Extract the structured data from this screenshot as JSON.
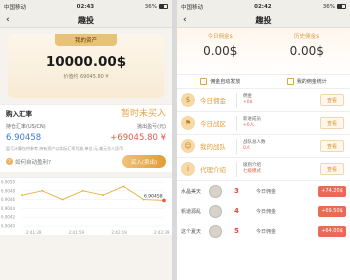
{
  "left": {
    "status": {
      "carrier": "中国移动",
      "network": "4G",
      "time": "02:43",
      "battery": "36%"
    },
    "nav": {
      "title": "趣投"
    },
    "asset": {
      "tab_label": "我的资产",
      "value": "10000.00$",
      "sub": "价值约 69045.80 ¥"
    },
    "rate": {
      "title": "购入汇率",
      "state": "暂时未买入",
      "label_left": "持仓汇率(US/CN)",
      "label_right": "抛出盈亏(元)",
      "value_left": "6.90458",
      "value_right": "+69045.80 ¥",
      "note": "盈亏计算仅供参考,持有资产以实际汇率为准,单位:元,美元兑人民币",
      "auto_question": "如何自动盈利?",
      "buy_label": "买入(卖出)"
    },
    "chart": {
      "y_ticks": [
        "6.9050",
        "6.9048",
        "6.9046",
        "6.9044",
        "6.9042",
        "6.9040"
      ],
      "x_ticks": [
        "2:41:39",
        "2:41:59",
        "2:42:19",
        "2:42:39"
      ],
      "last_label": "6.90458"
    }
  },
  "right": {
    "status": {
      "carrier": "中国移动",
      "network": "4G",
      "time": "02:42",
      "battery": "36%"
    },
    "nav": {
      "title": "趣投"
    },
    "balance": {
      "today_label": "今日佣金$",
      "today_value": "0.00$",
      "history_label": "历史佣金$",
      "history_value": "0.00$"
    },
    "tools": {
      "auto_send": "佣金自动发放",
      "stats": "我的佣金统计"
    },
    "menu": [
      {
        "title": "今日佣金",
        "info1": "佣金",
        "info2": "+0$",
        "btn": "查看",
        "icon": "coin-icon"
      },
      {
        "title": "今日战区",
        "info1": "新进成员",
        "info2": "+0人",
        "btn": "查看",
        "icon": "flag-icon"
      },
      {
        "title": "我的战队",
        "info1": "战队总人数",
        "info2": "0人",
        "btn": "查看",
        "icon": "team-icon"
      },
      {
        "title": "代理介绍",
        "info1": "级别介绍",
        "info2": "七级模式",
        "btn": "查看",
        "icon": "info-icon"
      }
    ],
    "ranking": [
      {
        "name": "水晶美天",
        "rank": "3",
        "label": "今日佣金",
        "amount": "+74.20$"
      },
      {
        "name": "帆道源乱",
        "rank": "4",
        "label": "今日佣金",
        "amount": "+69.50$"
      },
      {
        "name": "这个夏天",
        "rank": "5",
        "label": "今日佣金",
        "amount": "+64.00$"
      }
    ]
  },
  "chart_data": {
    "type": "line",
    "x": [
      "2:41:39",
      "2:41:49",
      "2:41:59",
      "2:42:09",
      "2:42:19",
      "2:42:29",
      "2:42:39",
      "2:42:49"
    ],
    "values": [
      6.9047,
      6.9048,
      6.9046,
      6.9048,
      6.9047,
      6.9049,
      6.9046,
      6.90458
    ],
    "ylim": [
      6.904,
      6.905
    ],
    "grid": true,
    "color": "#e3b23c"
  }
}
